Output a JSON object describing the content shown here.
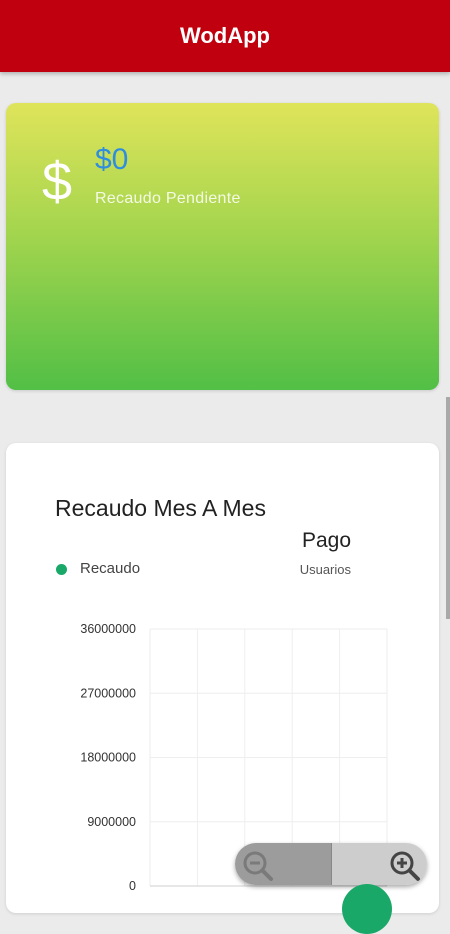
{
  "app": {
    "title": "WodApp"
  },
  "pending_card": {
    "icon": "dollar-icon",
    "amount": "$0",
    "label": "Recaudo Pendiente"
  },
  "chart_card": {
    "title": "Recaudo Mes A Mes",
    "subtitle": "Pago",
    "legend_label": "Recaudo",
    "users_label": "Usuarios"
  },
  "zoom": {
    "out_icon": "zoom-out-icon",
    "in_icon": "zoom-in-icon"
  },
  "colors": {
    "appbar": "#c0000f",
    "amount": "#2f8de0",
    "legend_dot": "#1aa868",
    "card_gradient_top": "#dfe45a",
    "card_gradient_bottom": "#52bf46"
  },
  "chart_data": {
    "type": "line",
    "series": [
      {
        "name": "Recaudo",
        "values": []
      }
    ],
    "y_ticks": [
      0,
      9000000,
      18000000,
      27000000,
      36000000
    ],
    "ylim": [
      0,
      36000000
    ],
    "grid": true,
    "legend": "top-left"
  }
}
